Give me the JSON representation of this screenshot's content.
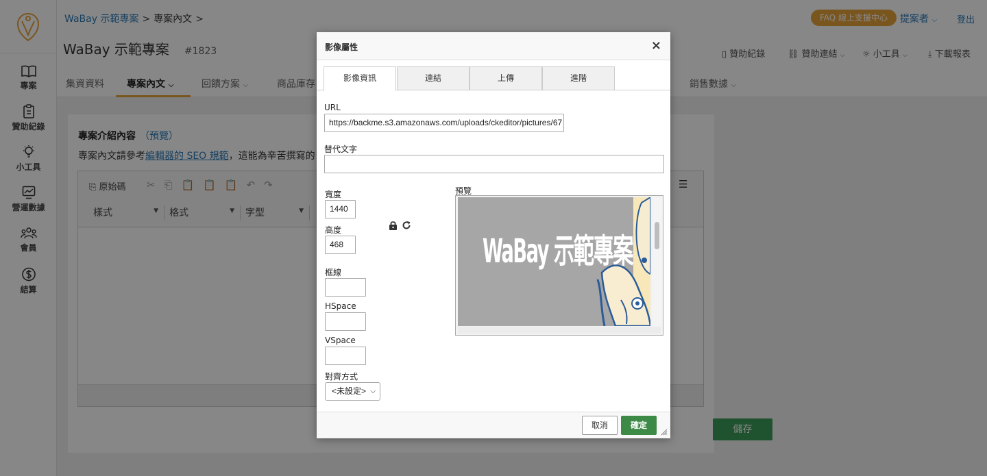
{
  "sidebar": {
    "items": [
      {
        "label": "專案",
        "icon": "book-icon"
      },
      {
        "label": "贊助紀錄",
        "icon": "clipboard-icon"
      },
      {
        "label": "小工具",
        "icon": "lightbulb-icon"
      },
      {
        "label": "營運數據",
        "icon": "chart-icon"
      },
      {
        "label": "會員",
        "icon": "members-icon"
      },
      {
        "label": "結算",
        "icon": "dollar-icon"
      }
    ]
  },
  "header": {
    "breadcrumb": [
      "WaBay 示範專案",
      "專案內文"
    ],
    "breadcrumb_sep": ">",
    "title": "WaBay 示範專案",
    "project_id": "#1823",
    "faq_label": "FAQ 線上支援中心",
    "user_label": "提案者",
    "logout_label": "登出",
    "tools": [
      "贊助紀錄",
      "贊助連結",
      "小工具",
      "下載報表"
    ]
  },
  "tabs": [
    "集資資料",
    "專案內文",
    "回饋方案",
    "商品庫存",
    "銷售數據"
  ],
  "card": {
    "section_title": "專案介紹內容",
    "preview_link": "（預覽）",
    "hint_prefix": "專案內文請參考",
    "hint_link": "編輯器的 SEO 規範",
    "hint_suffix": "，這能為辛苦撰寫的",
    "source_label": "原始碼",
    "combos": [
      "樣式",
      "格式",
      "字型"
    ],
    "save_label": "儲存"
  },
  "dialog": {
    "title": "影像屬性",
    "close_glyph": "×",
    "tabs": [
      "影像資訊",
      "連結",
      "上傳",
      "進階"
    ],
    "active_tab": 0,
    "url_label": "URL",
    "url_value": "https://backme.s3.amazonaws.com/uploads/ckeditor/pictures/67",
    "alt_label": "替代文字",
    "alt_value": "",
    "width_label": "寬度",
    "width_value": "1440",
    "height_label": "高度",
    "height_value": "468",
    "border_label": "框線",
    "border_value": "",
    "hspace_label": "HSpace",
    "hspace_value": "",
    "vspace_label": "VSpace",
    "vspace_value": "",
    "align_label": "對齊方式",
    "align_value": "<未設定>",
    "preview_label": "預覽",
    "preview_image_text": "WaBay 示範專案",
    "cancel_label": "取消",
    "ok_label": "確定"
  },
  "colors": {
    "accent": "#e6a23c",
    "link": "#2b7ab8",
    "primary_button": "#3c8a45",
    "save_button": "#3c9b5a"
  }
}
